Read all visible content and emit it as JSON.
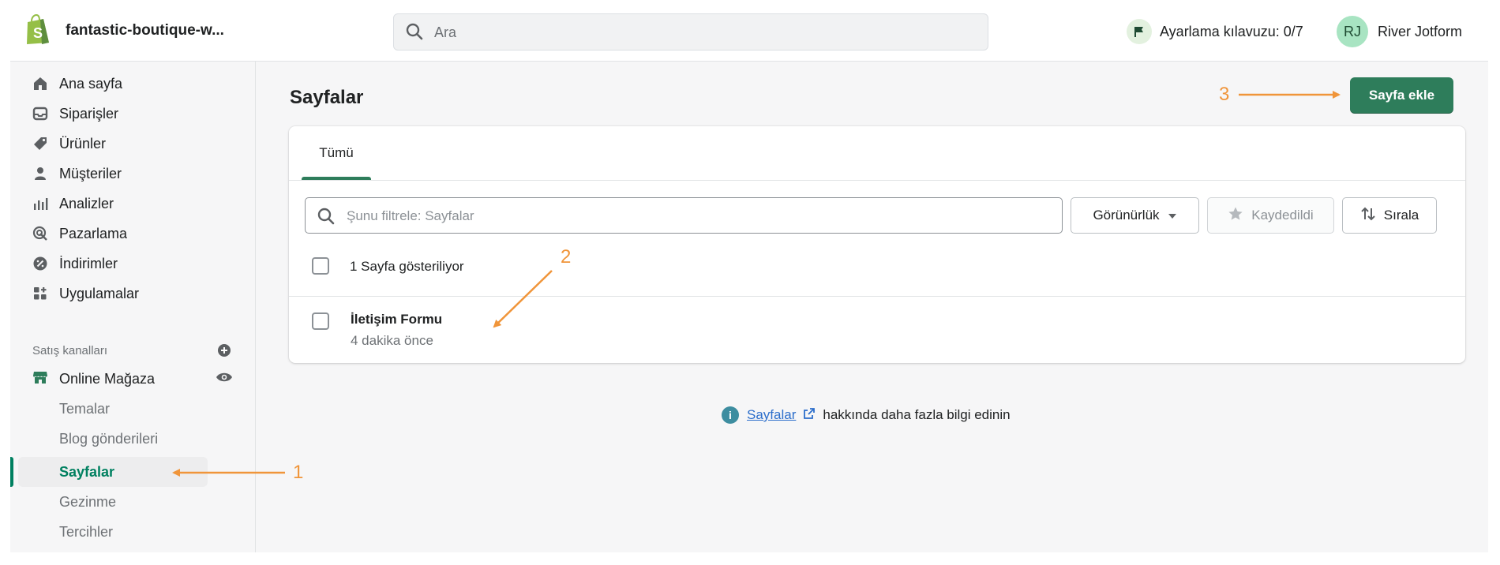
{
  "topbar": {
    "store_name": "fantastic-boutique-w...",
    "search_placeholder": "Ara",
    "setup_guide": "Ayarlama kılavuzu: 0/7",
    "user_initials": "RJ",
    "user_name": "River Jotform"
  },
  "sidebar": {
    "items": [
      {
        "label": "Ana sayfa",
        "icon": "home-icon"
      },
      {
        "label": "Siparişler",
        "icon": "inbox-icon"
      },
      {
        "label": "Ürünler",
        "icon": "tag-icon"
      },
      {
        "label": "Müşteriler",
        "icon": "person-icon"
      },
      {
        "label": "Analizler",
        "icon": "bar-chart-icon"
      },
      {
        "label": "Pazarlama",
        "icon": "target-icon"
      },
      {
        "label": "İndirimler",
        "icon": "discount-icon"
      },
      {
        "label": "Uygulamalar",
        "icon": "apps-icon"
      }
    ],
    "sales_channels_label": "Satış kanalları",
    "channel": "Online Mağaza",
    "sub_items": [
      "Temalar",
      "Blog gönderileri",
      "Sayfalar",
      "Gezinme",
      "Tercihler"
    ],
    "active_sub_item": "Sayfalar"
  },
  "main": {
    "page_title": "Sayfalar",
    "add_page_button": "Sayfa ekle",
    "tab_all": "Tümü",
    "filter_placeholder": "Şunu filtrele: Sayfalar",
    "visibility_button": "Görünürlük",
    "saved_button": "Kaydedildi",
    "sort_button": "Sırala",
    "count_label": "1 Sayfa gösteriliyor",
    "rows": [
      {
        "title": "İletişim Formu",
        "subtitle": "4 dakika önce"
      }
    ],
    "info_link": "Sayfalar",
    "info_text": "hakkında daha fazla bilgi edinin"
  },
  "annotations": {
    "n1": "1",
    "n2": "2",
    "n3": "3",
    "color": "#f0953a"
  },
  "colors": {
    "primary": "#2e7d5b",
    "active_nav": "#008060",
    "link": "#2c6ecb"
  }
}
